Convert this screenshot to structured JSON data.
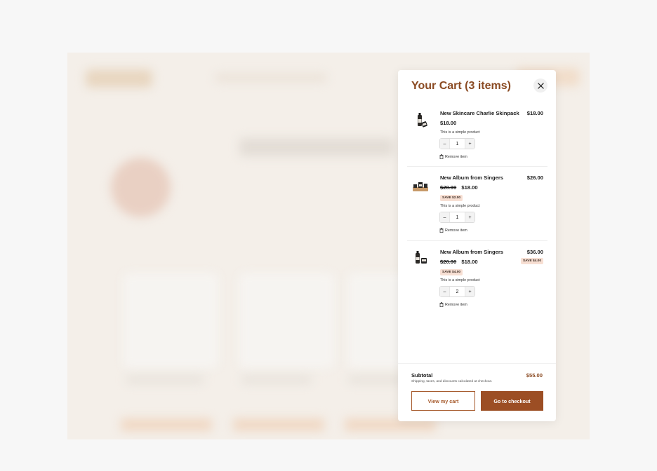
{
  "cart": {
    "title": "Your Cart (3 items)",
    "items": [
      {
        "name": "New Skincare Charlie Skinpack",
        "line_total": "$18.00",
        "price": "$18.00",
        "description": "This is a simple product",
        "quantity": "1",
        "remove_label": "Remove item"
      },
      {
        "name": "New Album from Singers",
        "line_total": "$26.00",
        "original_price": "$20.00",
        "price": "$18.00",
        "save_badge": "SAVE $2.00",
        "description": "This is a simple product",
        "quantity": "1",
        "remove_label": "Remove item"
      },
      {
        "name": "New Album from Singers",
        "line_total": "$36.00",
        "line_save_badge": "SAVE $4.00",
        "original_price": "$20.00",
        "price": "$18.00",
        "save_badge": "SAVE $4.00",
        "description": "This is a simple product",
        "quantity": "2",
        "remove_label": "Remove item"
      }
    ],
    "qty_minus": "–",
    "qty_plus": "+",
    "subtotal_label": "Subtotal",
    "subtotal_value": "$55.00",
    "shipping_note": "Shipping, taxes, and discounts calculated at checkout.",
    "view_cart_label": "View my cart",
    "checkout_label": "Go to checkout"
  },
  "colors": {
    "accent": "#8a4a22",
    "checkout_bg": "#9c4e24",
    "badge_bg": "#f7dfd3"
  },
  "icons": {
    "close": "close-icon",
    "remove": "trash-icon"
  }
}
